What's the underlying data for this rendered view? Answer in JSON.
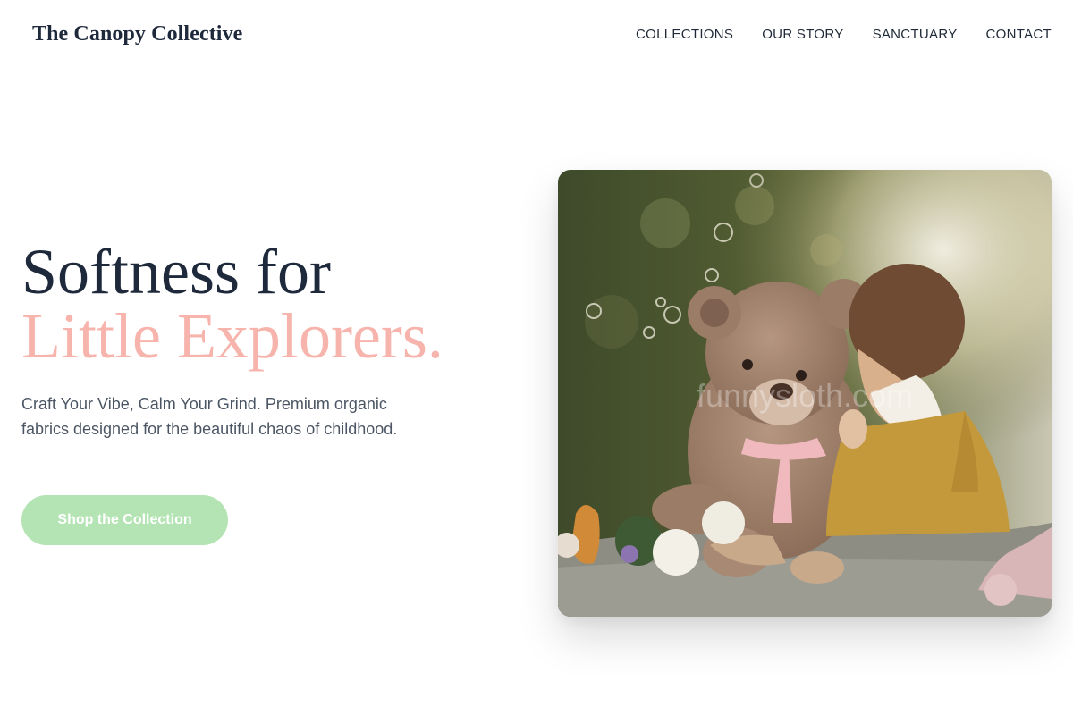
{
  "header": {
    "brand": "The Canopy Collective",
    "nav": [
      {
        "label": "COLLECTIONS"
      },
      {
        "label": "OUR STORY"
      },
      {
        "label": "SANCTUARY"
      },
      {
        "label": "CONTACT"
      }
    ]
  },
  "hero": {
    "title_line1": "Softness for",
    "title_line2": "Little Explorers.",
    "description": "Craft Your Vibe, Calm Your Grind. Premium organic fabrics designed for the beautiful chaos of childhood.",
    "cta_label": "Shop the Collection",
    "image_watermark": "funnysloth.com"
  },
  "colors": {
    "heading": "#1e293b",
    "accent_pink": "#f6b4ac",
    "cta_green": "#b4e4b4",
    "body_text": "#4b5563"
  }
}
